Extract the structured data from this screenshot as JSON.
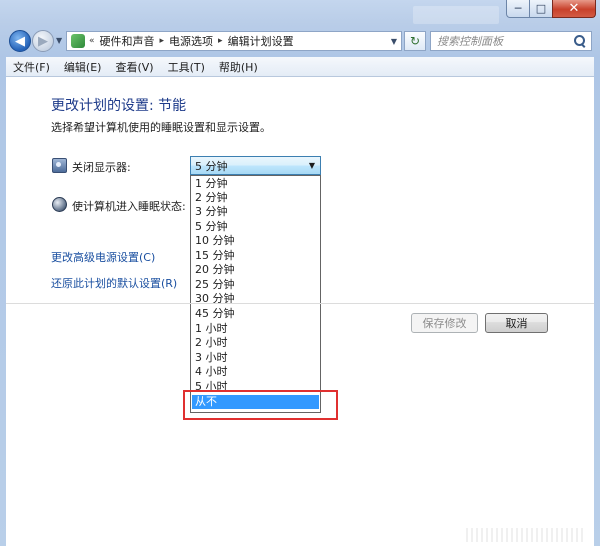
{
  "window": {
    "title_ghost": "",
    "controls": {
      "minimize": "─",
      "maximize": "□",
      "close": "✕"
    }
  },
  "nav": {
    "back_symbol": "◀",
    "forward_symbol": "▶",
    "history_dropdown": "▼",
    "address": {
      "prefix": "«",
      "segments": [
        "硬件和声音",
        "电源选项",
        "编辑计划设置"
      ],
      "separator": "▸",
      "dropdown": "▼"
    },
    "refresh_symbol": "↻",
    "search": {
      "placeholder": "搜索控制面板"
    }
  },
  "menubar": {
    "items": [
      "文件(F)",
      "编辑(E)",
      "查看(V)",
      "工具(T)",
      "帮助(H)"
    ]
  },
  "content": {
    "heading": "更改计划的设置: 节能",
    "subheading": "选择希望计算机使用的睡眠设置和显示设置。",
    "display_off": {
      "label": "关闭显示器:",
      "icon": "display-icon",
      "selected": "5 分钟",
      "arrow": "▼",
      "options": [
        "1 分钟",
        "2 分钟",
        "3 分钟",
        "5 分钟",
        "10 分钟",
        "15 分钟",
        "20 分钟",
        "25 分钟",
        "30 分钟",
        "45 分钟",
        "1 小时",
        "2 小时",
        "3 小时",
        "4 小时",
        "5 小时",
        "从不"
      ],
      "highlighted_option": "从不"
    },
    "sleep": {
      "label": "使计算机进入睡眠状态:",
      "icon": "sleep-icon"
    },
    "links": {
      "advanced": "更改高级电源设置(C)",
      "restore": "还原此计划的默认设置(R)"
    },
    "buttons": {
      "save": "保存修改",
      "cancel": "取消"
    }
  },
  "colors": {
    "heading": "#1e3b8a",
    "link": "#1a4fa0",
    "selection": "#3399ff",
    "annotation_box": "#e03030"
  }
}
